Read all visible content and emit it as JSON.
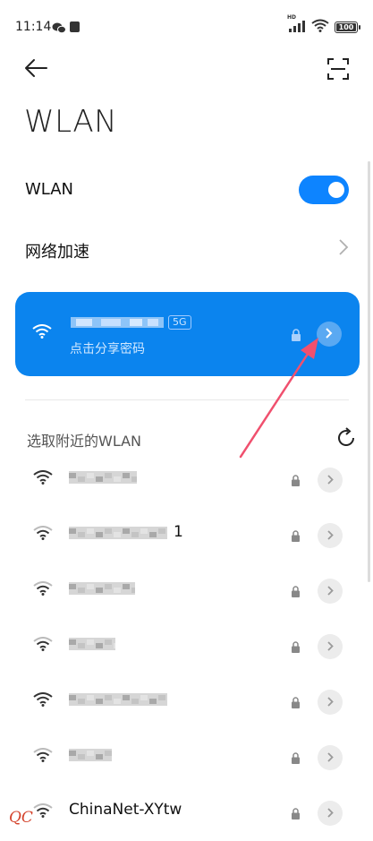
{
  "status_bar": {
    "time": "11:14",
    "network_badge": "HD",
    "battery": "100",
    "battery_level": 1.0
  },
  "header": {
    "back_icon": "arrow-left-icon",
    "scan_icon": "scan-qr-icon"
  },
  "page_title": "WLAN",
  "wlan_toggle": {
    "label": "WLAN",
    "on": true
  },
  "network_acceleration": {
    "label": "网络加速"
  },
  "connected_network": {
    "band_tag": "5G",
    "subtitle": "点击分享密码",
    "secured": true
  },
  "nearby": {
    "title": "选取附近的WLAN",
    "networks": [
      {
        "name": "",
        "signal": "full",
        "secured": true
      },
      {
        "name": "1",
        "signal": "high",
        "secured": true
      },
      {
        "name": "",
        "signal": "high",
        "secured": true
      },
      {
        "name": "",
        "signal": "high",
        "secured": true
      },
      {
        "name": "",
        "signal": "full",
        "secured": true
      },
      {
        "name": "",
        "signal": "high",
        "secured": true
      },
      {
        "name": "ChinaNet-XYtw",
        "signal": "high",
        "secured": true
      }
    ]
  },
  "watermark": "QC",
  "colors": {
    "accent": "#0d84ff",
    "card": "#0b84ee",
    "annotation_arrow": "#f0506e"
  }
}
